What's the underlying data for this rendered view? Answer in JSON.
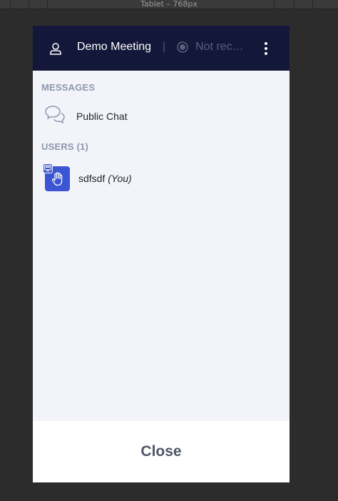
{
  "devtools": {
    "device_label": "Tablet – 768px"
  },
  "header": {
    "meeting_title": "Demo Meeting",
    "separator": "|",
    "recording_status": "Not recording",
    "icons": {
      "user": "user-icon",
      "recording": "record-icon",
      "options": "kebab-menu-icon"
    }
  },
  "messages": {
    "section_title": "MESSAGES",
    "items": [
      {
        "label": "Public Chat",
        "icon": "chat-bubbles-icon"
      }
    ]
  },
  "users": {
    "section_title": "USERS (1)",
    "items": [
      {
        "name": "sdfsdf",
        "suffix": "(You)",
        "status_icon": "raised-hand-icon",
        "badge_icon": "presenter-icon"
      }
    ]
  },
  "footer": {
    "close_label": "Close"
  },
  "colors": {
    "header_bg": "#13183a",
    "panel_bg": "#f3f4f9",
    "avatar_bg": "#3b55d3",
    "section_title": "#8e97ad",
    "page_bg": "#2c2c2c"
  }
}
